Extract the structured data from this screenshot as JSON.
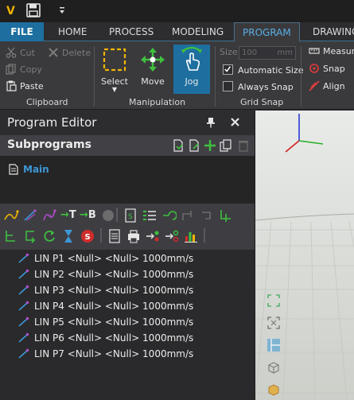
{
  "app": {
    "logo_letter": "V"
  },
  "tabs": [
    {
      "label": "FILE"
    },
    {
      "label": "HOME"
    },
    {
      "label": "PROCESS"
    },
    {
      "label": "MODELING"
    },
    {
      "label": "PROGRAM"
    },
    {
      "label": "DRAWING"
    }
  ],
  "ribbon": {
    "clipboard": {
      "cut": "Cut",
      "delete": "Delete",
      "copy": "Copy",
      "paste": "Paste",
      "label": "Clipboard"
    },
    "manipulation": {
      "select": "Select",
      "move": "Move",
      "jog": "Jog",
      "label": "Manipulation"
    },
    "grid_snap": {
      "size_label": "Size",
      "size_value": "100",
      "size_unit": "mm",
      "automatic_size": "Automatic Size",
      "always_snap": "Always Snap",
      "label": "Grid Snap"
    },
    "measure": {
      "measure": "Measure",
      "snap": "Snap",
      "align": "Align"
    }
  },
  "program_editor": {
    "title": "Program Editor",
    "subprograms_title": "Subprograms",
    "main_item": "Main",
    "statements": [
      {
        "text": "LIN P1 <Null> <Null> 1000mm/s"
      },
      {
        "text": "LIN P2 <Null> <Null> 1000mm/s"
      },
      {
        "text": "LIN P3 <Null> <Null> 1000mm/s"
      },
      {
        "text": "LIN P4 <Null> <Null> 1000mm/s"
      },
      {
        "text": "LIN P5 <Null> <Null> 1000mm/s"
      },
      {
        "text": "LIN P6 <Null> <Null> 1000mm/s"
      },
      {
        "text": "LIN P7 <Null> <Null> 1000mm/s"
      }
    ],
    "toolbar_labels": {
      "add_comment_t": "T",
      "add_comment_b": "B"
    }
  },
  "colors": {
    "accent": "#1e6fa0",
    "active_tab_text": "#5ab0e6",
    "main_link": "#3c97d6"
  }
}
